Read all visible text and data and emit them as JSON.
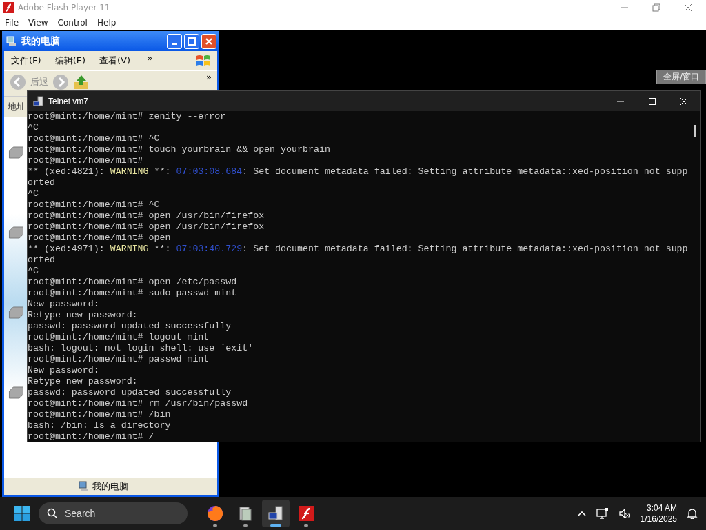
{
  "app": {
    "title": "Adobe Flash Player 11",
    "menu": [
      "File",
      "View",
      "Control",
      "Help"
    ]
  },
  "explorer": {
    "title": "我的电脑",
    "menu": [
      "文件(F)",
      "编辑(E)",
      "查看(V)"
    ],
    "menu_more": "»",
    "back_label": "后退",
    "toolbar_more": "»",
    "address_label": "地址",
    "status_text": "我的电脑"
  },
  "fullscreen_button": "全屏/窗口",
  "terminal": {
    "title": "Telnet vm7",
    "lines": [
      {
        "kind": "plain",
        "text": "root@mint:/home/mint# zenity --error"
      },
      {
        "kind": "plain",
        "text": "^C"
      },
      {
        "kind": "plain",
        "text": "root@mint:/home/mint# ^C"
      },
      {
        "kind": "plain",
        "text": "root@mint:/home/mint# touch yourbrain && open yourbrain"
      },
      {
        "kind": "plain",
        "text": "root@mint:/home/mint#"
      },
      {
        "kind": "warning",
        "source": "** (xed:4821):",
        "tag": "WARNING",
        "mark": "**:",
        "time": "07:03:08.684",
        "message": ": Set document metadata failed: Setting attribute metadata::xed-position not supp"
      },
      {
        "kind": "plain",
        "text": "orted"
      },
      {
        "kind": "plain",
        "text": "^C"
      },
      {
        "kind": "plain",
        "text": "root@mint:/home/mint# ^C"
      },
      {
        "kind": "plain",
        "text": "root@mint:/home/mint# open /usr/bin/firefox"
      },
      {
        "kind": "plain",
        "text": "root@mint:/home/mint# open /usr/bin/firefox"
      },
      {
        "kind": "plain",
        "text": "root@mint:/home/mint# open"
      },
      {
        "kind": "warning",
        "source": "** (xed:4971):",
        "tag": "WARNING",
        "mark": "**:",
        "time": "07:03:40.729",
        "message": ": Set document metadata failed: Setting attribute metadata::xed-position not supp"
      },
      {
        "kind": "plain",
        "text": "orted"
      },
      {
        "kind": "plain",
        "text": "^C"
      },
      {
        "kind": "plain",
        "text": "root@mint:/home/mint# open /etc/passwd"
      },
      {
        "kind": "plain",
        "text": "root@mint:/home/mint# sudo passwd mint"
      },
      {
        "kind": "plain",
        "text": "New password:"
      },
      {
        "kind": "plain",
        "text": "Retype new password:"
      },
      {
        "kind": "plain",
        "text": "passwd: password updated successfully"
      },
      {
        "kind": "plain",
        "text": "root@mint:/home/mint# logout mint"
      },
      {
        "kind": "plain",
        "text": "bash: logout: not login shell: use `exit'"
      },
      {
        "kind": "plain",
        "text": "root@mint:/home/mint# passwd mint"
      },
      {
        "kind": "plain",
        "text": "New password:"
      },
      {
        "kind": "plain",
        "text": "Retype new password:"
      },
      {
        "kind": "plain",
        "text": "passwd: password updated successfully"
      },
      {
        "kind": "plain",
        "text": "root@mint:/home/mint# rm /usr/bin/passwd"
      },
      {
        "kind": "plain",
        "text": "root@mint:/home/mint# /bin"
      },
      {
        "kind": "plain",
        "text": "bash: /bin: Is a directory"
      },
      {
        "kind": "plain",
        "text": "root@mint:/home/mint# /"
      }
    ]
  },
  "taskbar": {
    "search_placeholder": "Search",
    "apps": [
      {
        "kind": "browser",
        "selected": false
      },
      {
        "kind": "files",
        "selected": false
      },
      {
        "kind": "telnet",
        "selected": true
      },
      {
        "kind": "flash",
        "selected": false
      }
    ],
    "time": "3:04 AM",
    "date": "1/16/2025"
  }
}
